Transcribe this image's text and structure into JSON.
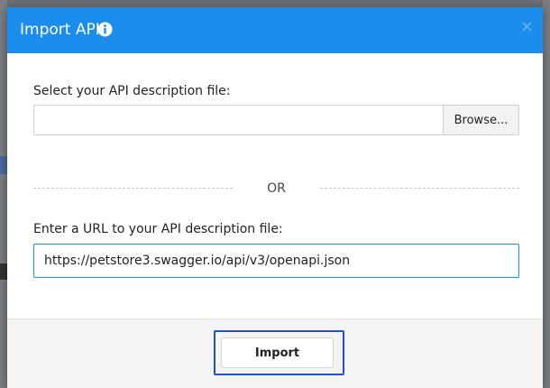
{
  "dialog": {
    "title": "Import API",
    "close_glyph": "×",
    "header_color": "#1a8ded"
  },
  "file_section": {
    "label": "Select your API description file:",
    "file_value": "",
    "browse_label": "Browse..."
  },
  "divider": {
    "or_label": "OR"
  },
  "url_section": {
    "label": "Enter a URL to your API description file:",
    "value": "https://petstore3.swagger.io/api/v3/openapi.json"
  },
  "footer": {
    "import_label": "Import"
  },
  "icons": {
    "info": "info-icon",
    "close": "close-icon"
  }
}
